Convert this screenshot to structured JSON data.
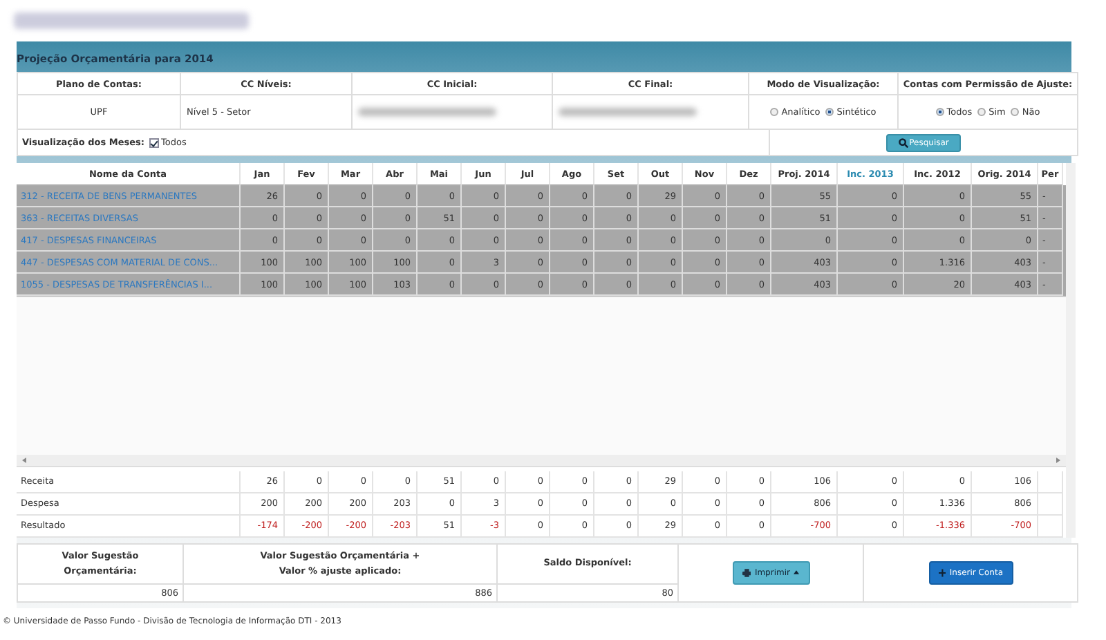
{
  "panel": {
    "title": "Projeção Orçamentária para 2014"
  },
  "filters": {
    "headers": [
      "Plano de Contas:",
      "CC Níveis:",
      "CC Inicial:",
      "CC Final:",
      "Modo de Visualização:",
      "Contas com Permissão de Ajuste:"
    ],
    "plano": "UPF",
    "nivel": "Nível 5 - Setor",
    "view_mode": [
      {
        "label": "Analítico",
        "selected": false
      },
      {
        "label": "Sintético",
        "selected": true
      }
    ],
    "permission": [
      {
        "label": "Todos",
        "selected": true
      },
      {
        "label": "Sim",
        "selected": false
      },
      {
        "label": "Não",
        "selected": false
      }
    ],
    "months_label": "Visualização dos Meses:",
    "months_option": {
      "label": "Todos",
      "checked": true
    },
    "search_button": "Pesquisar"
  },
  "table": {
    "columns": [
      {
        "label": "Nome da Conta",
        "highlighted": false
      },
      {
        "label": "Jan",
        "highlighted": false
      },
      {
        "label": "Fev",
        "highlighted": false
      },
      {
        "label": "Mar",
        "highlighted": false
      },
      {
        "label": "Abr",
        "highlighted": false
      },
      {
        "label": "Mai",
        "highlighted": false
      },
      {
        "label": "Jun",
        "highlighted": false
      },
      {
        "label": "Jul",
        "highlighted": false
      },
      {
        "label": "Ago",
        "highlighted": false
      },
      {
        "label": "Set",
        "highlighted": false
      },
      {
        "label": "Out",
        "highlighted": false
      },
      {
        "label": "Nov",
        "highlighted": false
      },
      {
        "label": "Dez",
        "highlighted": false
      },
      {
        "label": "Proj. 2014",
        "highlighted": false
      },
      {
        "label": "Inc. 2013",
        "highlighted": true
      },
      {
        "label": "Inc. 2012",
        "highlighted": false
      },
      {
        "label": "Orig. 2014",
        "highlighted": false
      },
      {
        "label": "Per",
        "highlighted": false
      }
    ],
    "rows": [
      {
        "name": "312 - RECEITA DE BENS PERMANENTES",
        "values": [
          "26",
          "0",
          "0",
          "0",
          "0",
          "0",
          "0",
          "0",
          "0",
          "29",
          "0",
          "0",
          "55",
          "0",
          "0",
          "55",
          "-"
        ]
      },
      {
        "name": "363 - RECEITAS DIVERSAS",
        "values": [
          "0",
          "0",
          "0",
          "0",
          "51",
          "0",
          "0",
          "0",
          "0",
          "0",
          "0",
          "0",
          "51",
          "0",
          "0",
          "51",
          "-"
        ]
      },
      {
        "name": "417 - DESPESAS FINANCEIRAS",
        "values": [
          "0",
          "0",
          "0",
          "0",
          "0",
          "0",
          "0",
          "0",
          "0",
          "0",
          "0",
          "0",
          "0",
          "0",
          "0",
          "0",
          "-"
        ]
      },
      {
        "name": "447 - DESPESAS COM MATERIAL DE CONS...",
        "values": [
          "100",
          "100",
          "100",
          "100",
          "0",
          "3",
          "0",
          "0",
          "0",
          "0",
          "0",
          "0",
          "403",
          "0",
          "1.316",
          "403",
          "-"
        ]
      },
      {
        "name": "1055 - DESPESAS DE TRANSFERÊNCIAS I...",
        "values": [
          "100",
          "100",
          "100",
          "103",
          "0",
          "0",
          "0",
          "0",
          "0",
          "0",
          "0",
          "0",
          "403",
          "0",
          "20",
          "403",
          "-"
        ]
      }
    ]
  },
  "totals": [
    {
      "label": "Receita",
      "cells": [
        {
          "text": "26",
          "negative": false
        },
        {
          "text": "0",
          "negative": false
        },
        {
          "text": "0",
          "negative": false
        },
        {
          "text": "0",
          "negative": false
        },
        {
          "text": "51",
          "negative": false
        },
        {
          "text": "0",
          "negative": false
        },
        {
          "text": "0",
          "negative": false
        },
        {
          "text": "0",
          "negative": false
        },
        {
          "text": "0",
          "negative": false
        },
        {
          "text": "29",
          "negative": false
        },
        {
          "text": "0",
          "negative": false
        },
        {
          "text": "0",
          "negative": false
        },
        {
          "text": "106",
          "negative": false
        },
        {
          "text": "0",
          "negative": false
        },
        {
          "text": "0",
          "negative": false
        },
        {
          "text": "106",
          "negative": false
        }
      ]
    },
    {
      "label": "Despesa",
      "cells": [
        {
          "text": "200",
          "negative": false
        },
        {
          "text": "200",
          "negative": false
        },
        {
          "text": "200",
          "negative": false
        },
        {
          "text": "203",
          "negative": false
        },
        {
          "text": "0",
          "negative": false
        },
        {
          "text": "3",
          "negative": false
        },
        {
          "text": "0",
          "negative": false
        },
        {
          "text": "0",
          "negative": false
        },
        {
          "text": "0",
          "negative": false
        },
        {
          "text": "0",
          "negative": false
        },
        {
          "text": "0",
          "negative": false
        },
        {
          "text": "0",
          "negative": false
        },
        {
          "text": "806",
          "negative": false
        },
        {
          "text": "0",
          "negative": false
        },
        {
          "text": "1.336",
          "negative": false
        },
        {
          "text": "806",
          "negative": false
        }
      ]
    },
    {
      "label": "Resultado",
      "cells": [
        {
          "text": "-174",
          "negative": true
        },
        {
          "text": "-200",
          "negative": true
        },
        {
          "text": "-200",
          "negative": true
        },
        {
          "text": "-203",
          "negative": true
        },
        {
          "text": "51",
          "negative": false
        },
        {
          "text": "-3",
          "negative": true
        },
        {
          "text": "0",
          "negative": false
        },
        {
          "text": "0",
          "negative": false
        },
        {
          "text": "0",
          "negative": false
        },
        {
          "text": "29",
          "negative": false
        },
        {
          "text": "0",
          "negative": false
        },
        {
          "text": "0",
          "negative": false
        },
        {
          "text": "-700",
          "negative": true
        },
        {
          "text": "0",
          "negative": false
        },
        {
          "text": "-1.336",
          "negative": true
        },
        {
          "text": "-700",
          "negative": true
        }
      ]
    }
  ],
  "summary": {
    "items": [
      {
        "label_lines": [
          "Valor Sugestão",
          "Orçamentária:"
        ],
        "value": "806"
      },
      {
        "label_lines": [
          "Valor Sugestão Orçamentária +",
          "Valor % ajuste aplicado:"
        ],
        "value": "886"
      },
      {
        "label_lines": [
          "Saldo Disponível:"
        ],
        "value": "80"
      }
    ],
    "print_button": "Imprimir",
    "insert_button": "Inserir Conta"
  },
  "footer": "© Universidade de Passo Fundo - Divisão de Tecnologia de Informação DTI - 2013"
}
